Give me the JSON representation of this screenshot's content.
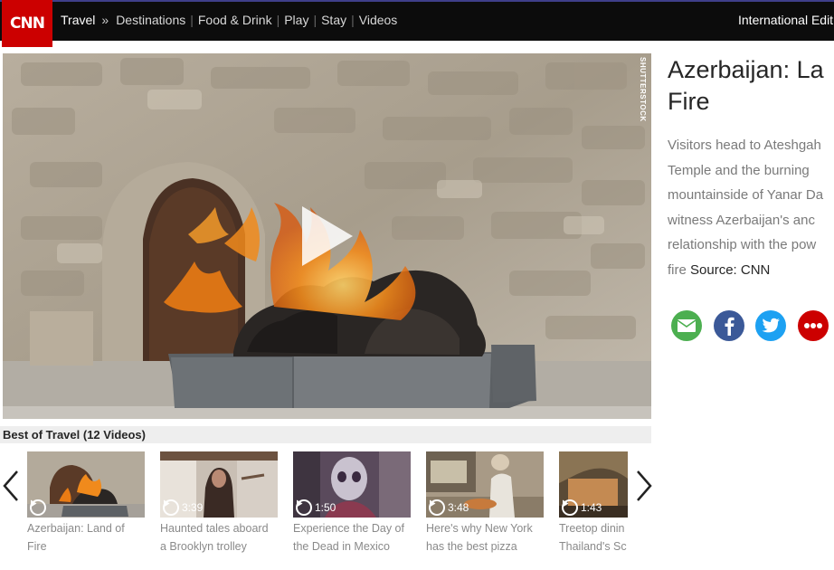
{
  "header": {
    "logo": "CNN",
    "section": "Travel",
    "separator": "»",
    "nav_links": [
      "Destinations",
      "Food & Drink",
      "Play",
      "Stay",
      "Videos"
    ],
    "edition": "International Editi"
  },
  "video": {
    "watermark": "SHUTTERSTOCK",
    "play_icon": "play-icon"
  },
  "article": {
    "headline_lines": [
      "Azerbaijan: La",
      "Fire"
    ],
    "description_lines": [
      "Visitors head to Ateshgah",
      "Temple and the burning",
      "mountainside of Yanar Da",
      "witness Azerbaijan's anc",
      "relationship with the pow",
      "fire "
    ],
    "source": "Source: CNN"
  },
  "social": {
    "icons": [
      "email-icon",
      "facebook-icon",
      "twitter-icon",
      "more-icon"
    ],
    "colors": {
      "email": "#4caf50",
      "facebook": "#3b5998",
      "twitter": "#1da1f2",
      "more": "#cc0000"
    }
  },
  "playlist": {
    "title": "Best of Travel (12 Videos)",
    "items": [
      {
        "duration": "",
        "caption": [
          "Azerbaijan: Land of",
          "Fire"
        ]
      },
      {
        "duration": "3:39",
        "caption": [
          "Haunted tales aboard",
          "a Brooklyn trolley"
        ]
      },
      {
        "duration": "1:50",
        "caption": [
          "Experience the Day of",
          "the Dead in Mexico"
        ]
      },
      {
        "duration": "3:48",
        "caption": [
          "Here's why New York",
          "has the best pizza"
        ]
      },
      {
        "duration": "1:43",
        "caption": [
          "Treetop dinin",
          "Thailand's Sc"
        ]
      }
    ]
  },
  "colors": {
    "cnn_red": "#cc0000",
    "header_bg": "#0c0c0c"
  }
}
